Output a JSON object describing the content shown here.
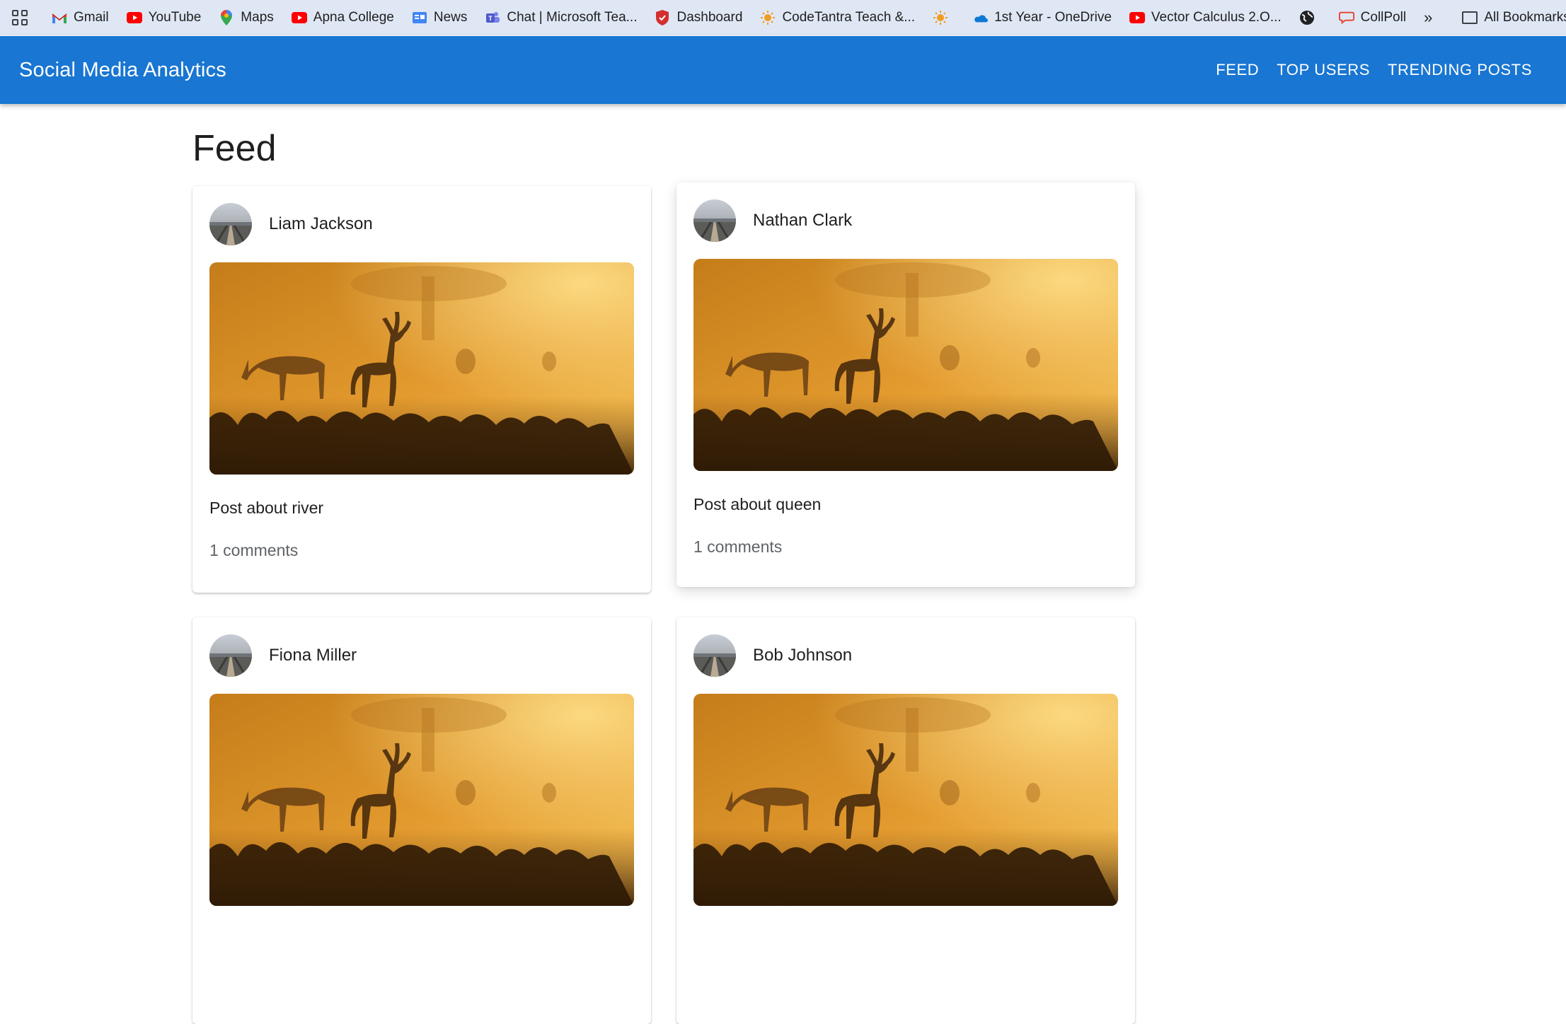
{
  "bookmarks": [
    {
      "label": "Gmail",
      "icon": "gmail-icon"
    },
    {
      "label": "YouTube",
      "icon": "youtube-icon"
    },
    {
      "label": "Maps",
      "icon": "maps-icon"
    },
    {
      "label": "Apna College",
      "icon": "youtube-icon"
    },
    {
      "label": "News",
      "icon": "news-icon"
    },
    {
      "label": "Chat | Microsoft Tea...",
      "icon": "teams-icon"
    },
    {
      "label": "Dashboard",
      "icon": "shield-icon"
    },
    {
      "label": "CodeTantra Teach &...",
      "icon": "sun-icon"
    },
    {
      "label": "",
      "icon": "sun-icon"
    },
    {
      "label": "1st Year - OneDrive",
      "icon": "onedrive-icon"
    },
    {
      "label": "Vector Calculus 2.O...",
      "icon": "youtube-icon"
    },
    {
      "label": "",
      "icon": "globe-icon"
    },
    {
      "label": "CollPoll",
      "icon": "speech-bubble-icon"
    }
  ],
  "bookmarks_more": "»",
  "all_bookmarks": "All Bookmarks",
  "appbar": {
    "title": "Social Media Analytics",
    "nav": [
      "FEED",
      "TOP USERS",
      "TRENDING POSTS"
    ]
  },
  "feed": {
    "title": "Feed",
    "posts": [
      {
        "author": "Liam Jackson",
        "text": "Post about river",
        "comments": "1 comments"
      },
      {
        "author": "Nathan Clark",
        "text": "Post about queen",
        "comments": "1 comments"
      },
      {
        "author": "Fiona Miller",
        "text": "",
        "comments": ""
      },
      {
        "author": "Bob Johnson",
        "text": "",
        "comments": ""
      }
    ]
  },
  "colors": {
    "appbar": "#1976d2",
    "bookmarks_bar": "#dfe7f5"
  }
}
